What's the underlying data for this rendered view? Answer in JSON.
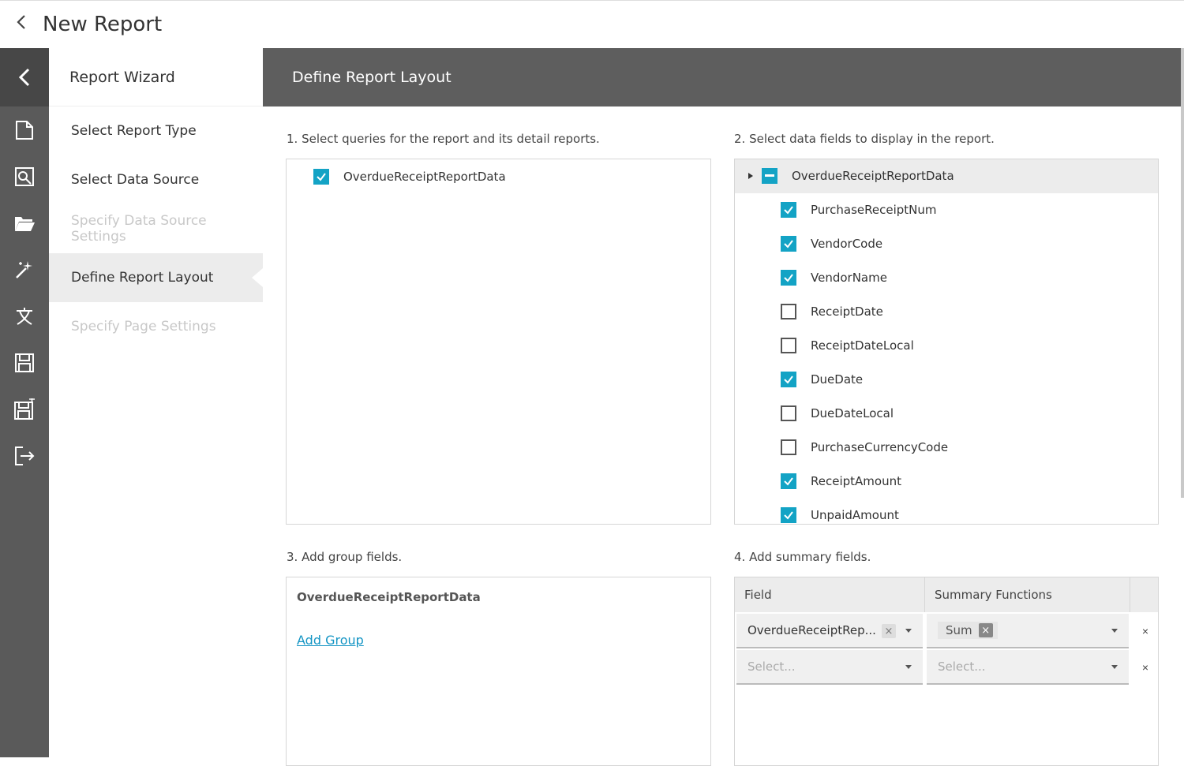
{
  "titlebar": {
    "back_icon": "chevron-left-icon",
    "title": "New Report"
  },
  "leftbar": {
    "collapse_icon": "chevron-left-icon",
    "icons": [
      "new-report-icon",
      "design-icon",
      "open-icon",
      "wizard-icon",
      "localization-icon",
      "save-icon",
      "save-as-icon",
      "exit-icon"
    ]
  },
  "wizard": {
    "title": "Report Wizard",
    "steps": [
      {
        "label": "Select Report Type",
        "state": "done"
      },
      {
        "label": "Select Data Source",
        "state": "done"
      },
      {
        "label": "Specify Data Source Settings",
        "state": "disabled"
      },
      {
        "label": "Define Report Layout",
        "state": "active"
      },
      {
        "label": "Specify Page Settings",
        "state": "disabled"
      }
    ]
  },
  "page": {
    "title": "Define Report Layout"
  },
  "section1": {
    "label": "1. Select queries for the report and its detail reports.",
    "queries": [
      {
        "label": "OverdueReceiptReportData",
        "checked": true
      }
    ]
  },
  "section2": {
    "label": "2. Select data fields to display in the report.",
    "root": {
      "label": "OverdueReceiptReportData",
      "state": "indeterminate"
    },
    "fields": [
      {
        "label": "PurchaseReceiptNum",
        "checked": true
      },
      {
        "label": "VendorCode",
        "checked": true
      },
      {
        "label": "VendorName",
        "checked": true
      },
      {
        "label": "ReceiptDate",
        "checked": false
      },
      {
        "label": "ReceiptDateLocal",
        "checked": false
      },
      {
        "label": "DueDate",
        "checked": true
      },
      {
        "label": "DueDateLocal",
        "checked": false
      },
      {
        "label": "PurchaseCurrencyCode",
        "checked": false
      },
      {
        "label": "ReceiptAmount",
        "checked": true
      },
      {
        "label": "UnpaidAmount",
        "checked": true
      }
    ]
  },
  "section3": {
    "label": "3. Add group fields.",
    "query_name": "OverdueReceiptReportData",
    "add_group": "Add Group"
  },
  "section4": {
    "label": "4. Add summary fields.",
    "col_field": "Field",
    "col_functions": "Summary Functions",
    "rows": [
      {
        "field": "OverdueReceiptRep...",
        "function": "Sum"
      }
    ],
    "placeholder": "Select...",
    "remove_glyph": "×"
  },
  "colors": {
    "accent": "#13a3c5",
    "sidebar": "#5a5a5a",
    "header": "#5e5e5e",
    "link": "#1495c4"
  }
}
